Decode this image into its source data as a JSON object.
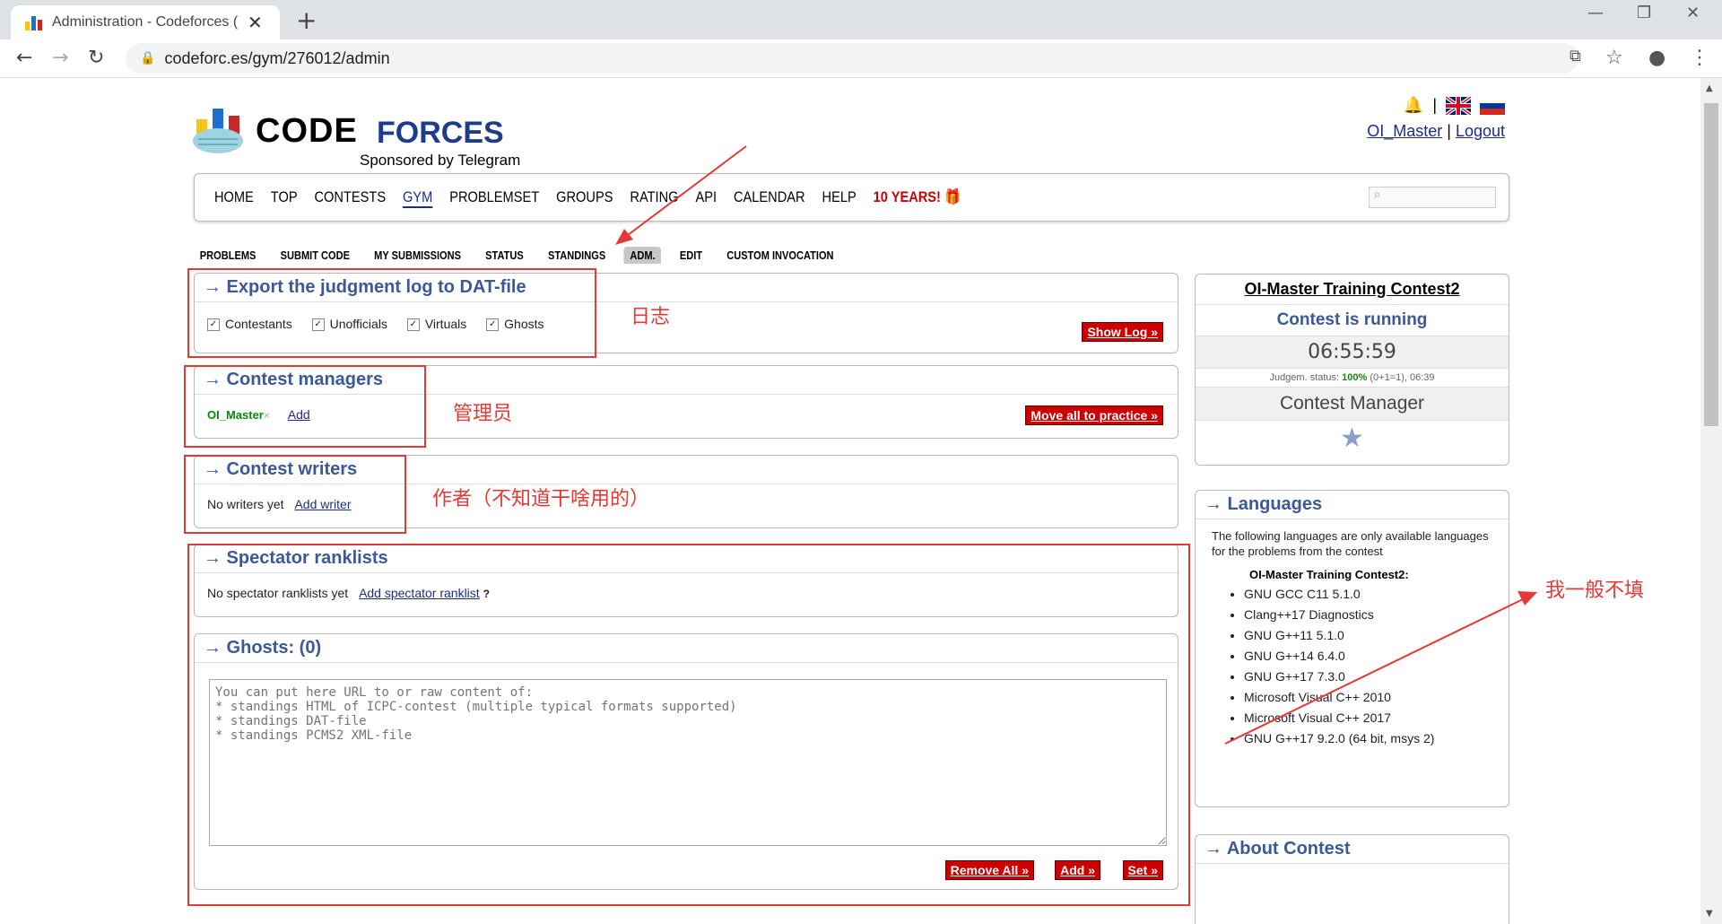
{
  "browser": {
    "tab_title": "Administration - Codeforces (",
    "url": "codeforc.es/gym/276012/admin"
  },
  "header": {
    "logo_code": "CODE",
    "logo_forces": "FORCES",
    "logo_sub": "Sponsored by Telegram",
    "user": "OI_Master",
    "separator": "|",
    "logout": "Logout"
  },
  "menu": [
    "HOME",
    "TOP",
    "CONTESTS",
    "GYM",
    "PROBLEMSET",
    "GROUPS",
    "RATING",
    "API",
    "CALENDAR",
    "HELP",
    "10 YEARS!"
  ],
  "submenu": [
    "PROBLEMS",
    "SUBMIT CODE",
    "MY SUBMISSIONS",
    "STATUS",
    "STANDINGS",
    "ADM.",
    "EDIT",
    "CUSTOM INVOCATION"
  ],
  "export": {
    "title": "→ Export the judgment log to DAT-file",
    "checks": [
      "Contestants",
      "Unofficials",
      "Virtuals",
      "Ghosts"
    ],
    "button": "Show Log »"
  },
  "managers": {
    "title": "→ Contest managers",
    "manager": "OI_Master",
    "remove_glyph": "×",
    "add": "Add",
    "button": "Move all to practice »"
  },
  "writers": {
    "title": "→ Contest writers",
    "empty": "No writers yet",
    "add": "Add writer"
  },
  "spectator": {
    "title": "→ Spectator ranklists",
    "empty": "No spectator ranklists yet",
    "add": "Add spectator ranklist",
    "help": "?"
  },
  "ghosts": {
    "title": "→ Ghosts: (0)",
    "placeholder": "You can put here URL to or raw content of:\n* standings HTML of ICPC-contest (multiple typical formats supported)\n* standings DAT-file\n* standings PCMS2 XML-file",
    "remove_all": "Remove All »",
    "add": "Add »",
    "set": "Set »"
  },
  "sidebar": {
    "contest_name": "OI-Master Training Contest2",
    "status": "Contest is running",
    "timer": "06:55:59",
    "judgem_label": "Judgem. status:",
    "judgem_pct": "100%",
    "judgem_detail": "(0+1=1), 06:39",
    "role": "Contest Manager",
    "languages_title": "→ Languages",
    "languages_note": "The following languages are only available languages for the problems from the contest",
    "languages_contest": "OI-Master Training Contest2:",
    "languages": [
      "GNU GCC C11 5.1.0",
      "Clang++17 Diagnostics",
      "GNU G++11 5.1.0",
      "GNU G++14 6.4.0",
      "GNU G++17 7.3.0",
      "Microsoft Visual C++ 2010",
      "Microsoft Visual C++ 2017",
      "GNU G++17 9.2.0 (64 bit, msys 2)"
    ],
    "about_title": "→ About Contest"
  },
  "annotations": {
    "log": "日志",
    "managers": "管理员",
    "writers": "作者（不知道干啥用的）",
    "languages": "我一般不填"
  },
  "colors": {
    "accent": "#3b5998",
    "red": "#cc0000",
    "annotation": "#e53935"
  }
}
